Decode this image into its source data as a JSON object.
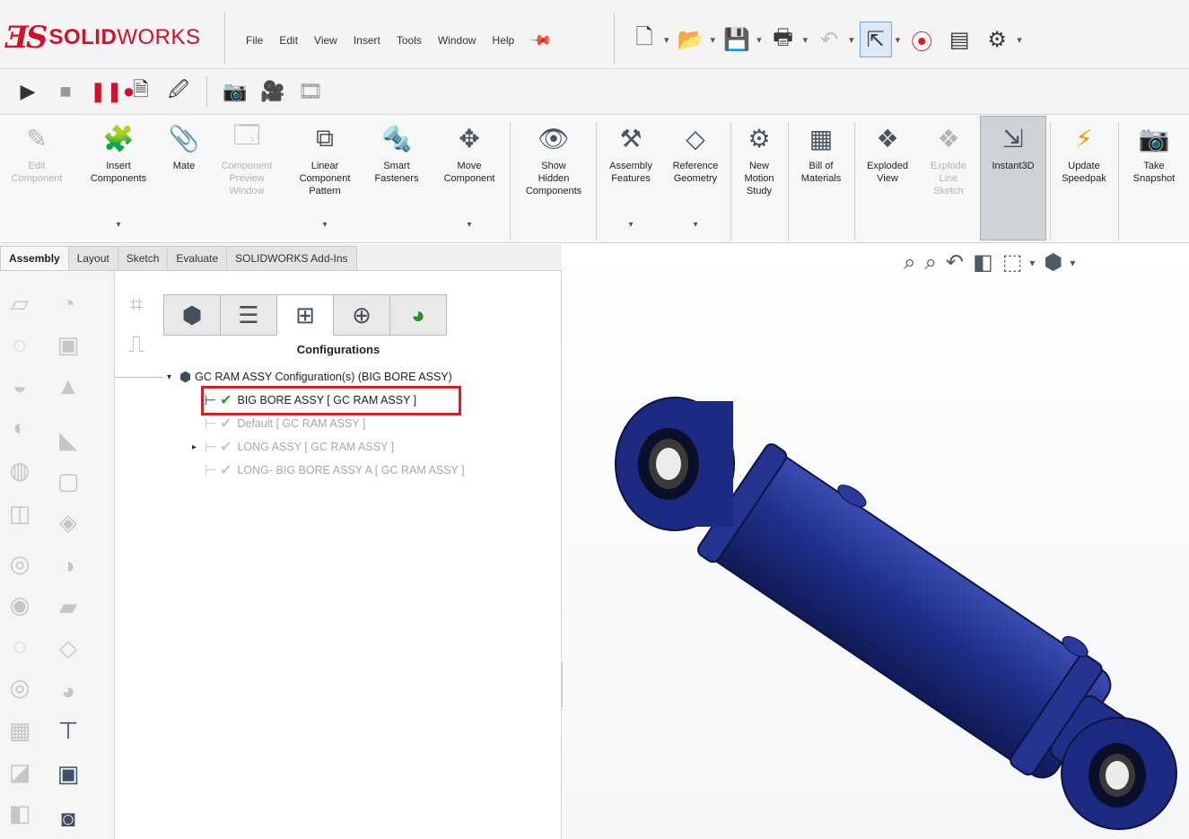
{
  "app": {
    "brand_ds": "ƎS",
    "brand_bold": "SOLID",
    "brand_light": "WORKS"
  },
  "menu": [
    "File",
    "Edit",
    "View",
    "Insert",
    "Tools",
    "Window",
    "Help"
  ],
  "command_manager": {
    "buttons": [
      {
        "label": "Edit\nComponent",
        "icon": "edit-component-icon",
        "enabled": false
      },
      {
        "label": "Insert\nComponents",
        "icon": "insert-components-icon",
        "enabled": true,
        "has_dropdown": true
      },
      {
        "label": "Mate",
        "icon": "mate-icon",
        "enabled": true
      },
      {
        "label": "Component\nPreview\nWindow",
        "icon": "component-preview-icon",
        "enabled": false
      },
      {
        "label": "Linear\nComponent\nPattern",
        "icon": "linear-pattern-icon",
        "enabled": true,
        "has_dropdown": true
      },
      {
        "label": "Smart\nFasteners",
        "icon": "smart-fasteners-icon",
        "enabled": true
      },
      {
        "label": "Move\nComponent",
        "icon": "move-component-icon",
        "enabled": true,
        "has_dropdown": true
      },
      {
        "label": "Show\nHidden\nComponents",
        "icon": "show-hidden-icon",
        "enabled": true
      },
      {
        "label": "Assembly\nFeatures",
        "icon": "assembly-features-icon",
        "enabled": true,
        "has_dropdown": true
      },
      {
        "label": "Reference\nGeometry",
        "icon": "reference-geometry-icon",
        "enabled": true,
        "has_dropdown": true
      },
      {
        "label": "New\nMotion\nStudy",
        "icon": "motion-study-icon",
        "enabled": true
      },
      {
        "label": "Bill of\nMaterials",
        "icon": "bom-icon",
        "enabled": true
      },
      {
        "label": "Exploded\nView",
        "icon": "exploded-view-icon",
        "enabled": true
      },
      {
        "label": "Explode\nLine\nSketch",
        "icon": "explode-line-icon",
        "enabled": false
      },
      {
        "label": "Instant3D",
        "icon": "instant3d-icon",
        "enabled": true,
        "active": true
      },
      {
        "label": "Update\nSpeedpak",
        "icon": "speedpak-icon",
        "enabled": true
      },
      {
        "label": "Take\nSnapshot",
        "icon": "snapshot-icon",
        "enabled": true
      }
    ]
  },
  "tabs": [
    "Assembly",
    "Layout",
    "Sketch",
    "Evaluate",
    "SOLIDWORKS Add-Ins"
  ],
  "feature_manager": {
    "panel_title": "Configurations",
    "root": "GC RAM ASSY Configuration(s)  (BIG BORE ASSY)",
    "configs": [
      {
        "label": "BIG BORE ASSY [ GC RAM ASSY ]",
        "active": true
      },
      {
        "label": "Default [ GC RAM ASSY ]",
        "active": false
      },
      {
        "label": "LONG ASSY [ GC RAM ASSY ]",
        "active": false,
        "expandable": true
      },
      {
        "label": "LONG- BIG BORE ASSY A [ GC RAM ASSY ]",
        "active": false
      }
    ]
  },
  "colors": {
    "brand_red": "#d0112b",
    "model_blue": "#1f2f8a",
    "highlight_red": "#d42128",
    "active_check": "#25a52d"
  }
}
